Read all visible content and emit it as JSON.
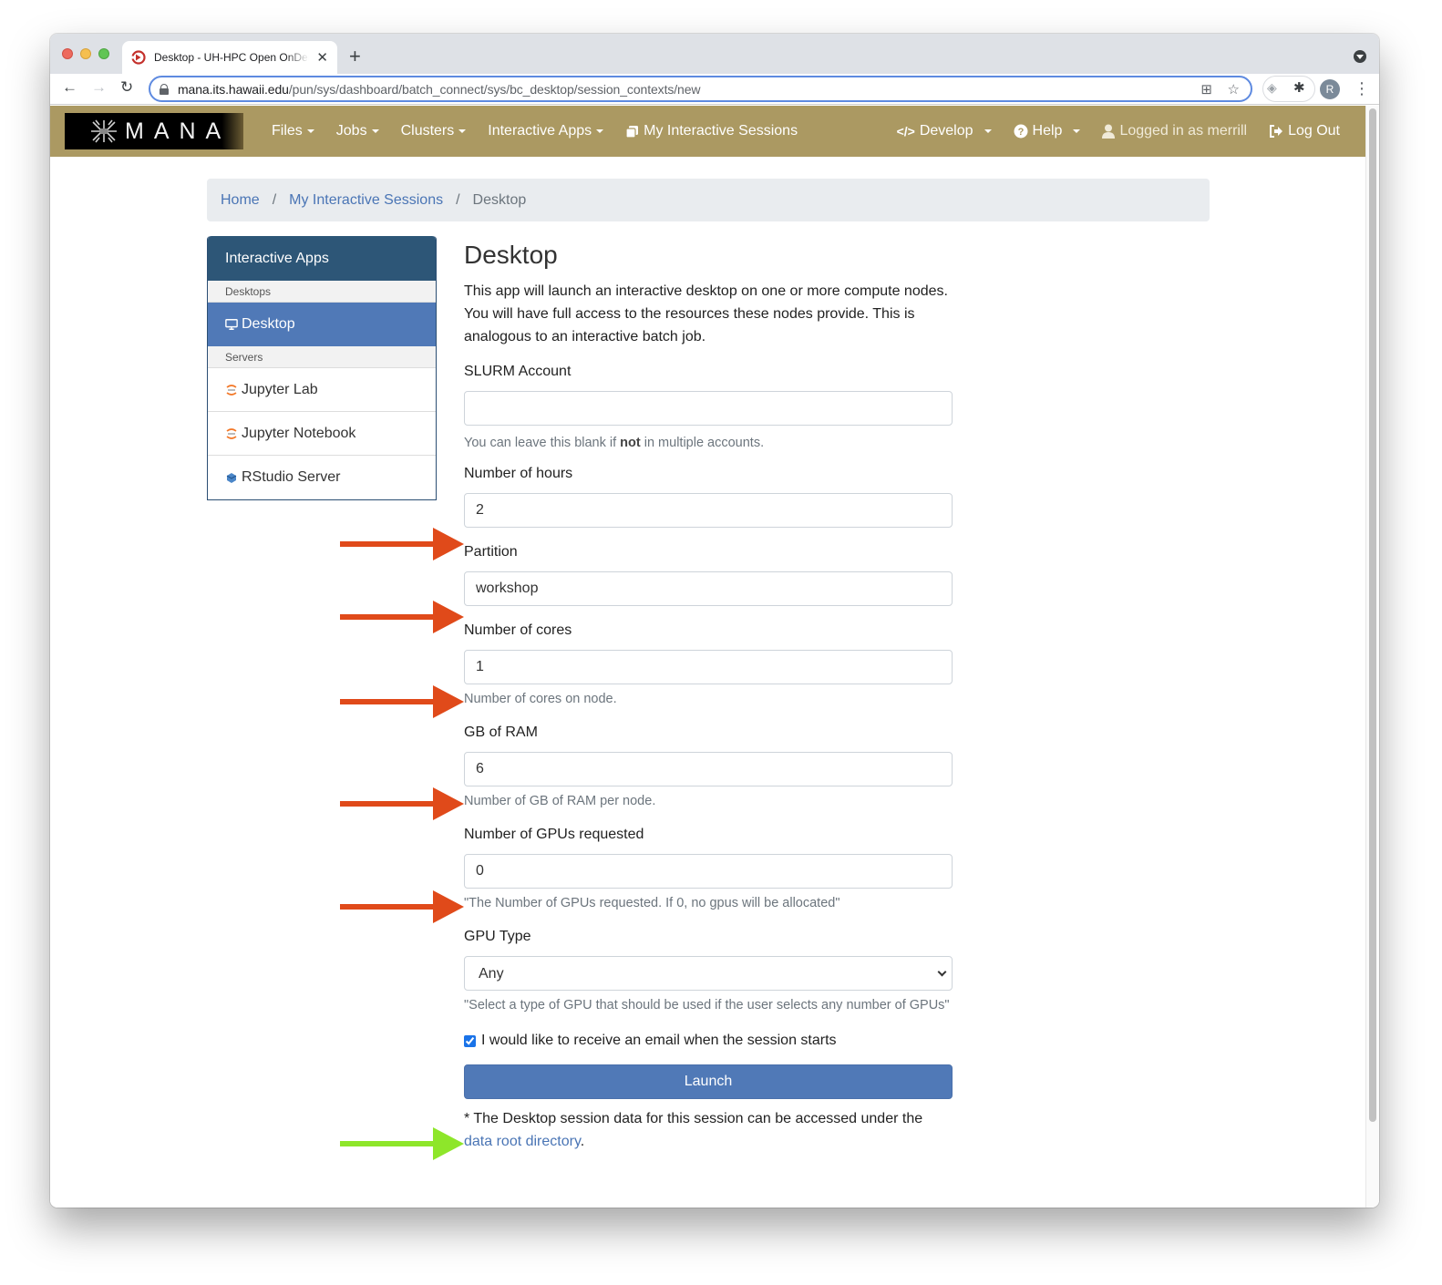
{
  "browser": {
    "tab_title": "Desktop - UH-HPC Open OnDemand",
    "new_tab_label": "+",
    "url_host": "mana.its.hawaii.edu",
    "url_path": "/pun/sys/dashboard/batch_connect/sys/bc_desktop/session_contexts/new",
    "profile_initial": "R",
    "icons": [
      "back-icon",
      "forward-icon",
      "reload-icon",
      "lock-icon",
      "qr-code-icon",
      "bookmark-star-icon",
      "extension-icon",
      "puzzle-icon",
      "kebab-menu-icon",
      "tab-search-icon"
    ]
  },
  "navbar": {
    "brand": "MANA",
    "items": [
      {
        "label": "Files",
        "dropdown": true
      },
      {
        "label": "Jobs",
        "dropdown": true
      },
      {
        "label": "Clusters",
        "dropdown": true
      },
      {
        "label": "Interactive Apps",
        "dropdown": true
      },
      {
        "label": "My Interactive Sessions",
        "icon": "sessions-icon"
      }
    ],
    "right_items": [
      {
        "label": "Develop",
        "icon": "code-icon",
        "dropdown": true
      },
      {
        "label": "Help",
        "icon": "question-circle-icon",
        "dropdown": true
      },
      {
        "label": "Logged in as merrill",
        "icon": "user-icon"
      },
      {
        "label": "Log Out",
        "icon": "sign-out-icon"
      }
    ],
    "color": "#ab9962"
  },
  "breadcrumb": {
    "items": [
      "Home",
      "My Interactive Sessions"
    ],
    "active": "Desktop"
  },
  "sidebar": {
    "header": "Interactive Apps",
    "sections": [
      {
        "title": "Desktops",
        "items": [
          {
            "label": "Desktop",
            "icon": "monitor-icon",
            "active": true
          }
        ]
      },
      {
        "title": "Servers",
        "items": [
          {
            "label": "Jupyter Lab",
            "icon": "jupyter-icon"
          },
          {
            "label": "Jupyter Notebook",
            "icon": "jupyter-icon"
          },
          {
            "label": "RStudio Server",
            "icon": "rstudio-icon"
          }
        ]
      }
    ]
  },
  "form": {
    "title": "Desktop",
    "description": "This app will launch an interactive desktop on one or more compute nodes. You will have full access to the resources these nodes provide. This is analogous to an interactive batch job.",
    "fields": {
      "slurm_account": {
        "label": "SLURM Account",
        "value": "",
        "help_pre": "You can leave this blank if ",
        "help_bold": "not",
        "help_post": " in multiple accounts."
      },
      "hours": {
        "label": "Number of hours",
        "value": "2"
      },
      "partition": {
        "label": "Partition",
        "value": "workshop"
      },
      "cores": {
        "label": "Number of cores",
        "value": "1",
        "help": "Number of cores on node."
      },
      "ram": {
        "label": "GB of RAM",
        "value": "6",
        "help": "Number of GB of RAM per node."
      },
      "gpus": {
        "label": "Number of GPUs requested",
        "value": "0",
        "help": "\"The Number of GPUs requested. If 0, no gpus will be allocated\""
      },
      "gpu_type": {
        "label": "GPU Type",
        "value": "Any",
        "help": "\"Select a type of GPU that should be used if the user selects any number of GPUs\""
      }
    },
    "email_checkbox": {
      "label": "I would like to receive an email when the session starts",
      "checked": true
    },
    "launch_label": "Launch",
    "footnote_pre": "* The Desktop session data for this session can be accessed under the ",
    "footnote_link": "data root directory",
    "footnote_post": "."
  },
  "annotations": {
    "arrow_color_fields": "#e04a1a",
    "arrow_color_launch": "#8ee62a",
    "arrow_targets": [
      "hours",
      "partition",
      "cores",
      "ram",
      "gpus",
      "launch"
    ]
  }
}
